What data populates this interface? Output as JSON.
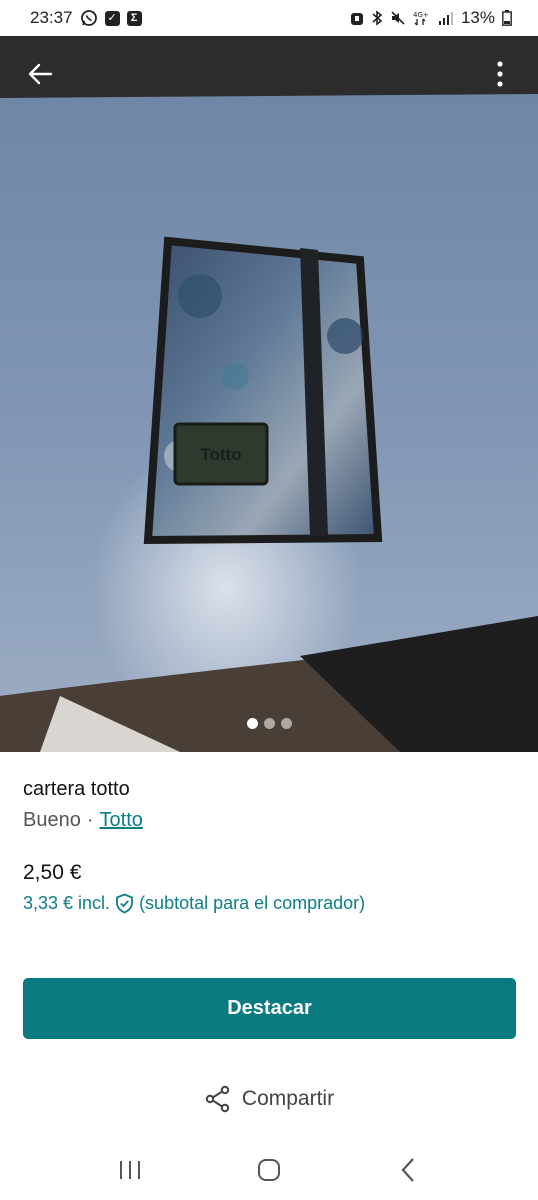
{
  "status_bar": {
    "time": "23:37",
    "battery_pct": "13%",
    "network": "4G+"
  },
  "photo": {
    "image_count": 3,
    "active_index": 0,
    "brand_patch_text": "Totto"
  },
  "item": {
    "title": "cartera totto",
    "condition": "Bueno",
    "separator": "·",
    "brand": "Totto"
  },
  "pricing": {
    "price": "2,50 €",
    "price_incl": "3,33 € incl.",
    "note": "(subtotal para el comprador)"
  },
  "actions": {
    "primary_label": "Destacar",
    "share_label": "Compartir"
  },
  "colors": {
    "accent": "#097a80",
    "link": "#0b7f86"
  }
}
